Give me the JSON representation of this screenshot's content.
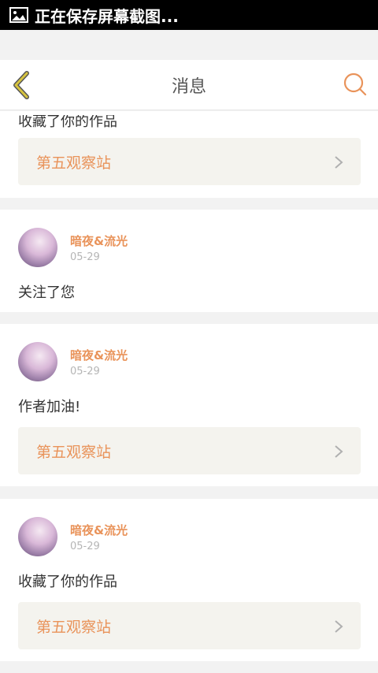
{
  "status_bar": {
    "text": "正在保存屏幕截图..."
  },
  "header": {
    "title": "消息"
  },
  "messages": [
    {
      "text": "收藏了你的作品",
      "work": "第五观察站"
    },
    {
      "user": "暗夜&流光",
      "date": "05-29",
      "text": "关注了您"
    },
    {
      "user": "暗夜&流光",
      "date": "05-29",
      "text": "作者加油!",
      "work": "第五观察站"
    },
    {
      "user": "暗夜&流光",
      "date": "05-29",
      "text": "收藏了你的作品",
      "work": "第五观察站"
    }
  ],
  "colors": {
    "accent": "#e9935a",
    "back_icon": "#d6c33f",
    "link_bg": "#f4f3ee"
  }
}
